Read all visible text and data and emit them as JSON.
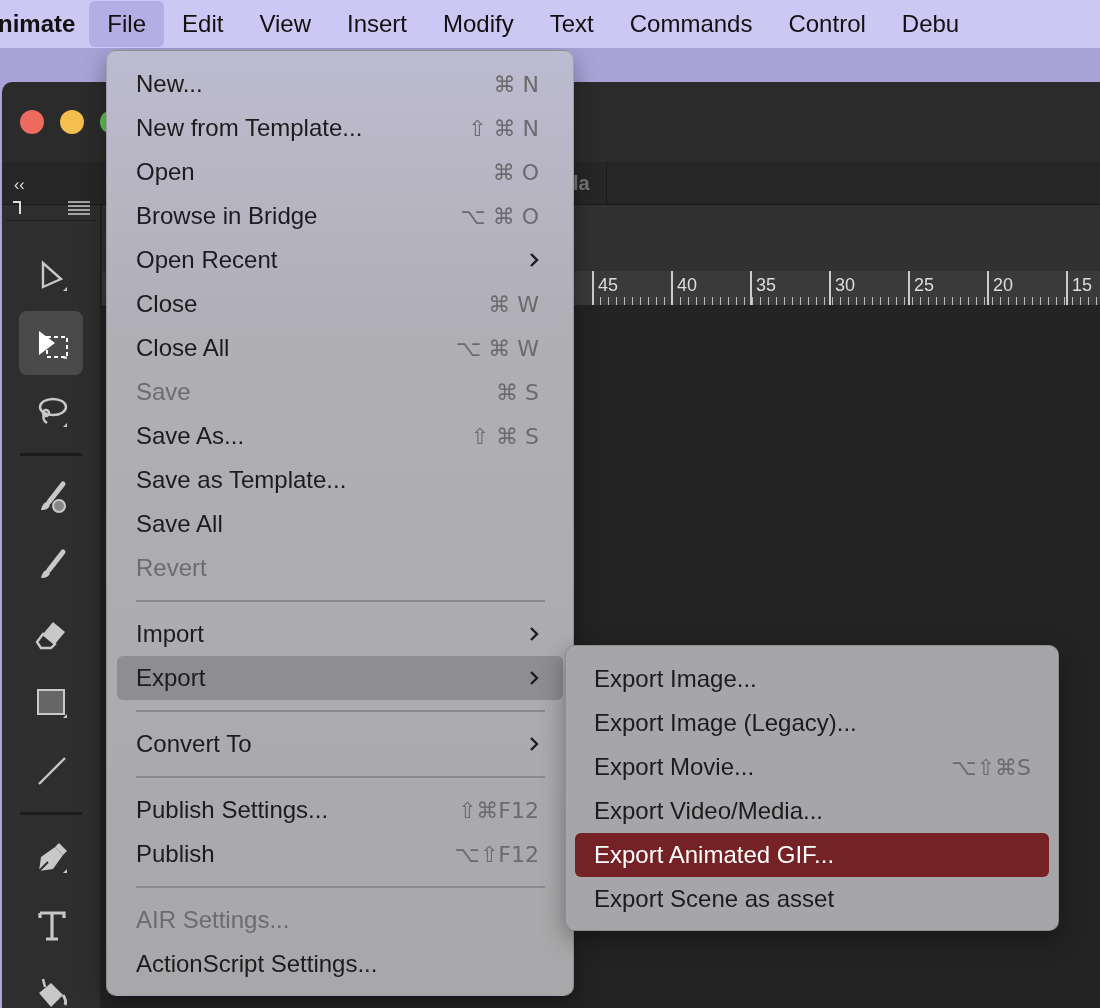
{
  "menu_bar": [
    {
      "label": "nimate",
      "kind": "app",
      "selected": false
    },
    {
      "label": "File",
      "kind": "menu",
      "selected": true
    },
    {
      "label": "Edit",
      "kind": "menu",
      "selected": false
    },
    {
      "label": "View",
      "kind": "menu",
      "selected": false
    },
    {
      "label": "Insert",
      "kind": "menu",
      "selected": false
    },
    {
      "label": "Modify",
      "kind": "menu",
      "selected": false
    },
    {
      "label": "Text",
      "kind": "menu",
      "selected": false
    },
    {
      "label": "Commands",
      "kind": "menu",
      "selected": false
    },
    {
      "label": "Control",
      "kind": "menu",
      "selected": false
    },
    {
      "label": "Debu",
      "kind": "menu",
      "selected": false
    }
  ],
  "app_window": {
    "collapse_label": "‹‹",
    "tab_label": "la",
    "ruler_labels": [
      "45",
      "40",
      "35",
      "30",
      "25",
      "20",
      "15"
    ],
    "tools": [
      {
        "kind": "arrow",
        "selected": false
      },
      {
        "kind": "marquee",
        "selected": true
      },
      {
        "kind": "lasso",
        "selected": false
      },
      {
        "kind": "separator"
      },
      {
        "kind": "artbrush",
        "selected": false
      },
      {
        "kind": "brush",
        "selected": false
      },
      {
        "kind": "eraser",
        "selected": false
      },
      {
        "kind": "rectangle",
        "selected": false
      },
      {
        "kind": "line",
        "selected": false
      },
      {
        "kind": "separator"
      },
      {
        "kind": "pen",
        "selected": false
      },
      {
        "kind": "type",
        "selected": false
      },
      {
        "kind": "bucket",
        "selected": false
      }
    ]
  },
  "file_menu": [
    {
      "kind": "item",
      "label": "New...",
      "shortcut": "⌘ N",
      "submenu": false,
      "disabled": false,
      "selected": false
    },
    {
      "kind": "item",
      "label": "New from Template...",
      "shortcut": "⇧ ⌘ N",
      "submenu": false,
      "disabled": false,
      "selected": false
    },
    {
      "kind": "item",
      "label": "Open",
      "shortcut": "⌘ O",
      "submenu": false,
      "disabled": false,
      "selected": false
    },
    {
      "kind": "item",
      "label": "Browse in Bridge",
      "shortcut": "⌥ ⌘ O",
      "submenu": false,
      "disabled": false,
      "selected": false
    },
    {
      "kind": "item",
      "label": "Open Recent",
      "submenu": true,
      "disabled": false,
      "selected": false
    },
    {
      "kind": "item",
      "label": "Close",
      "shortcut": "⌘ W",
      "submenu": false,
      "disabled": false,
      "selected": false
    },
    {
      "kind": "item",
      "label": "Close All",
      "shortcut": "⌥ ⌘ W",
      "submenu": false,
      "disabled": false,
      "selected": false
    },
    {
      "kind": "item",
      "label": "Save",
      "shortcut": "⌘ S",
      "submenu": false,
      "disabled": true,
      "selected": false
    },
    {
      "kind": "item",
      "label": "Save As...",
      "shortcut": "⇧ ⌘ S",
      "submenu": false,
      "disabled": false,
      "selected": false
    },
    {
      "kind": "item",
      "label": "Save as Template...",
      "submenu": false,
      "disabled": false,
      "selected": false
    },
    {
      "kind": "item",
      "label": "Save All",
      "submenu": false,
      "disabled": false,
      "selected": false
    },
    {
      "kind": "item",
      "label": "Revert",
      "submenu": false,
      "disabled": true,
      "selected": false
    },
    {
      "kind": "separator"
    },
    {
      "kind": "item",
      "label": "Import",
      "submenu": true,
      "disabled": false,
      "selected": false
    },
    {
      "kind": "item",
      "label": "Export",
      "submenu": true,
      "disabled": false,
      "selected": true
    },
    {
      "kind": "separator"
    },
    {
      "kind": "item",
      "label": "Convert To",
      "submenu": true,
      "disabled": false,
      "selected": false
    },
    {
      "kind": "separator"
    },
    {
      "kind": "item",
      "label": "Publish Settings...",
      "shortcut": "⇧⌘F12",
      "submenu": false,
      "disabled": false,
      "selected": false
    },
    {
      "kind": "item",
      "label": "Publish",
      "shortcut": "⌥⇧F12",
      "submenu": false,
      "disabled": false,
      "selected": false
    },
    {
      "kind": "separator"
    },
    {
      "kind": "item",
      "label": "AIR Settings...",
      "submenu": false,
      "disabled": true,
      "selected": false
    },
    {
      "kind": "item",
      "label": "ActionScript Settings...",
      "submenu": false,
      "disabled": false,
      "selected": false
    }
  ],
  "export_submenu": [
    {
      "kind": "item",
      "label": "Export Image...",
      "submenu": false,
      "disabled": false,
      "selected": false
    },
    {
      "kind": "item",
      "label": "Export Image (Legacy)...",
      "submenu": false,
      "disabled": false,
      "selected": false
    },
    {
      "kind": "item",
      "label": "Export Movie...",
      "shortcut": "⌥⇧⌘S",
      "submenu": false,
      "disabled": false,
      "selected": false
    },
    {
      "kind": "item",
      "label": "Export Video/Media...",
      "submenu": false,
      "disabled": false,
      "selected": false
    },
    {
      "kind": "item",
      "label": "Export Animated GIF...",
      "submenu": false,
      "disabled": false,
      "selected": true
    },
    {
      "kind": "item",
      "label": "Export Scene as asset",
      "submenu": false,
      "disabled": false,
      "selected": false
    }
  ]
}
